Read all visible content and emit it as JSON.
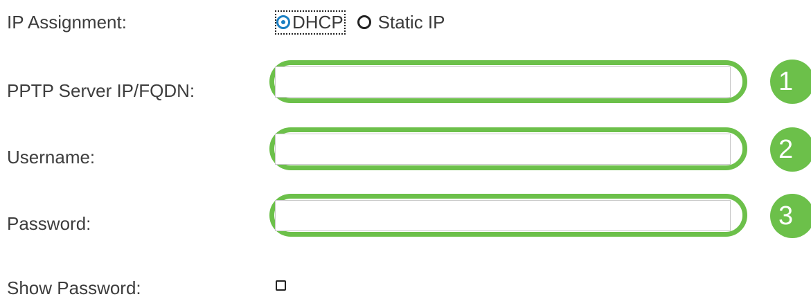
{
  "form": {
    "ip_assignment": {
      "label": "IP Assignment:",
      "options": [
        {
          "label": "DHCP",
          "selected": true
        },
        {
          "label": "Static IP",
          "selected": false
        }
      ]
    },
    "pptp_server": {
      "label": "PPTP Server IP/FQDN:",
      "value": "",
      "placeholder": "",
      "step": "1"
    },
    "username": {
      "label": "Username:",
      "value": "",
      "placeholder": "",
      "step": "2"
    },
    "password": {
      "label": "Password:",
      "value": "",
      "placeholder": "",
      "step": "3"
    },
    "show_password": {
      "label": "Show Password:",
      "checked": false
    }
  },
  "colors": {
    "highlight": "#6cc04a",
    "radio_selected": "#1a7fc3",
    "label_text": "#3d3d3d"
  }
}
